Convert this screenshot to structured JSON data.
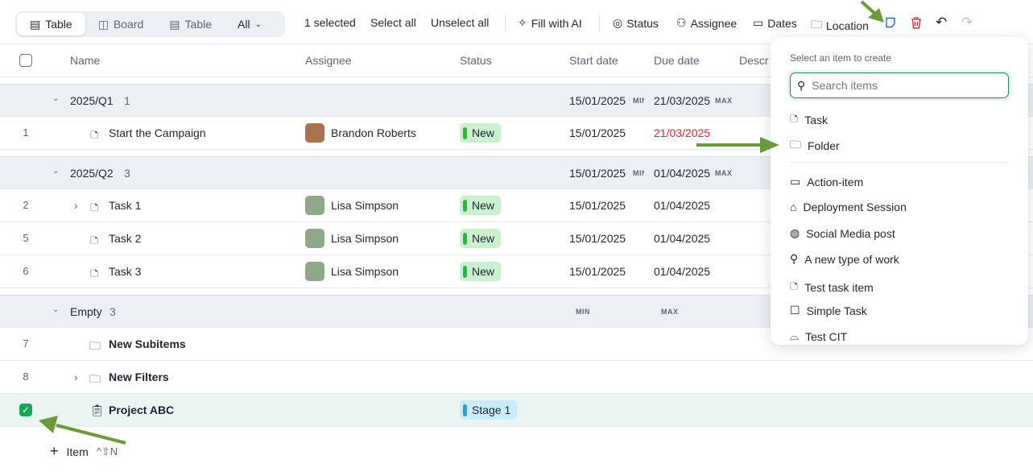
{
  "views": {
    "tabs": [
      {
        "label": "Table",
        "active": true
      },
      {
        "label": "Board"
      },
      {
        "label": "Table"
      }
    ],
    "filter": "All"
  },
  "toolbar": {
    "selected": "1 selected",
    "select_all": "Select all",
    "unselect_all": "Unselect all",
    "fill_ai": "Fill with AI",
    "status": "Status",
    "assignee": "Assignee",
    "dates": "Dates",
    "location": "Location"
  },
  "columns": {
    "name": "Name",
    "assignee": "Assignee",
    "status": "Status",
    "start": "Start date",
    "due": "Due date",
    "description": "Descr"
  },
  "groups": [
    {
      "label": "2025/Q1",
      "count": "1",
      "start": "15/01/2025",
      "due": "21/03/2025",
      "min": "MIN",
      "max": "MAX"
    },
    {
      "label": "2025/Q2",
      "count": "3",
      "start": "15/01/2025",
      "due": "01/04/2025",
      "min": "MIN",
      "max": "MAX"
    },
    {
      "label": "Empty",
      "count": "3",
      "min": "MIN",
      "max": "MAX"
    }
  ],
  "rows": [
    {
      "num": "1",
      "name": "Start the Campaign",
      "assignee": "Brandon Roberts",
      "status": "New",
      "start": "15/01/2025",
      "due": "21/03/2025"
    },
    {
      "num": "2",
      "name": "Task 1",
      "assignee": "Lisa Simpson",
      "status": "New",
      "start": "15/01/2025",
      "due": "01/04/2025"
    },
    {
      "num": "5",
      "name": "Task 2",
      "assignee": "Lisa Simpson",
      "status": "New",
      "start": "15/01/2025",
      "due": "01/04/2025"
    },
    {
      "num": "6",
      "name": "Task 3",
      "assignee": "Lisa Simpson",
      "status": "New",
      "start": "15/01/2025",
      "due": "01/04/2025"
    },
    {
      "num": "7",
      "name": "New Subitems"
    },
    {
      "num": "8",
      "name": "New Filters"
    },
    {
      "name": "Project ABC",
      "status": "Stage 1",
      "checked": true
    }
  ],
  "add_item": {
    "label": "Item",
    "shortcut": "^⇧N"
  },
  "popup": {
    "title": "Select an item to create",
    "search_placeholder": "Search items",
    "items": [
      "Task",
      "Folder",
      "Action-item",
      "Deployment Session",
      "Social Media post",
      "A new type of work",
      "Test task item",
      "Simple Task",
      "Test CIT"
    ]
  },
  "colors": {
    "new": "#c9f1cf",
    "new_bar": "#2fb344",
    "stage": "#c7ecfb",
    "stage_bar": "#2a9fd8",
    "overdue": "#d6263b",
    "arrow": "#6a9a3a"
  }
}
